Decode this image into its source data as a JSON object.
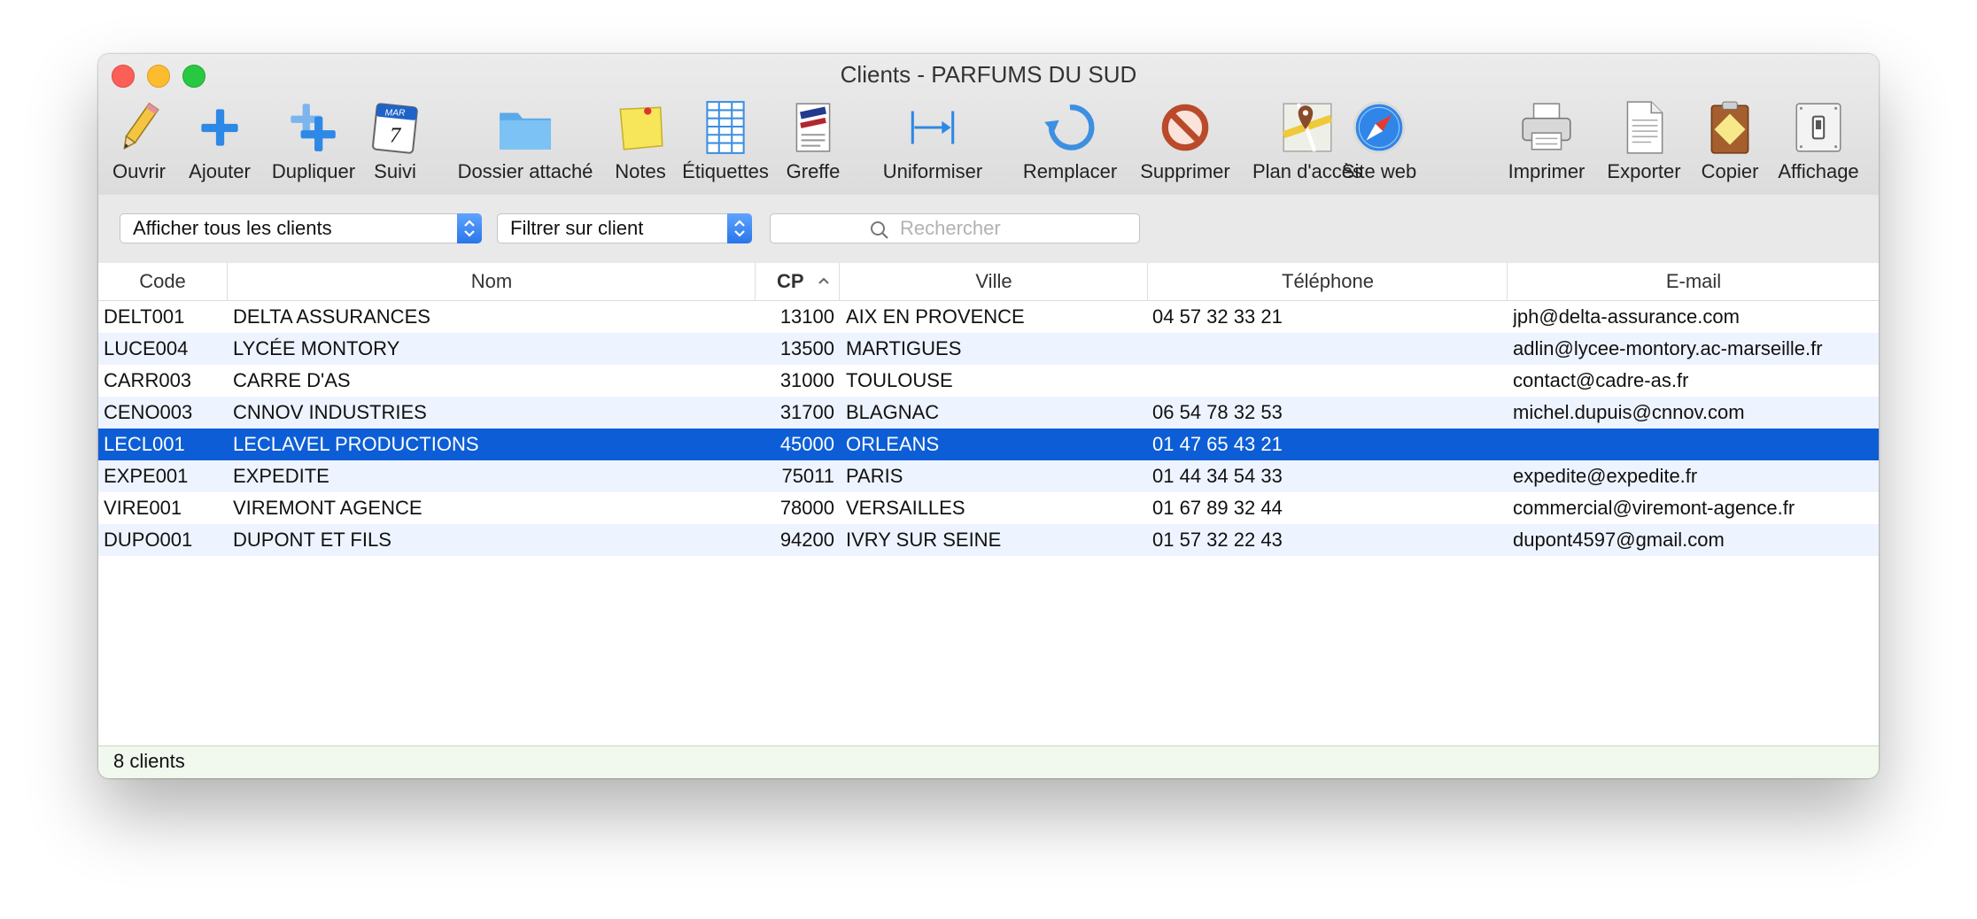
{
  "window": {
    "title": "Clients - PARFUMS DU SUD"
  },
  "toolbar": {
    "ouvrir": "Ouvrir",
    "ajouter": "Ajouter",
    "dupliquer": "Dupliquer",
    "suivi": "Suivi",
    "suivi_month": "MAR",
    "suivi_day": "7",
    "dossier": "Dossier attaché",
    "notes": "Notes",
    "etiquettes": "Étiquettes",
    "greffe": "Greffe",
    "uniformiser": "Uniformiser",
    "remplacer": "Remplacer",
    "supprimer": "Supprimer",
    "plan": "Plan d'accès",
    "site": "Site web",
    "imprimer": "Imprimer",
    "exporter": "Exporter",
    "copier": "Copier",
    "affichage": "Affichage"
  },
  "filters": {
    "show_select": "Afficher tous les clients",
    "filter_select": "Filtrer sur client",
    "search_placeholder": "Rechercher"
  },
  "table": {
    "columns": {
      "code": "Code",
      "nom": "Nom",
      "cp": "CP",
      "ville": "Ville",
      "telephone": "Téléphone",
      "email": "E-mail"
    },
    "sort_column": "CP",
    "sort_direction": "ascending",
    "selected_row": 4,
    "rows": [
      {
        "code": "DELT001",
        "nom": "DELTA ASSURANCES",
        "cp": "13100",
        "ville": "AIX EN PROVENCE",
        "tel": "04 57 32 33 21",
        "email": "jph@delta-assurance.com"
      },
      {
        "code": "LUCE004",
        "nom": "LYCÉE MONTORY",
        "cp": "13500",
        "ville": "MARTIGUES",
        "tel": "",
        "email": "adlin@lycee-montory.ac-marseille.fr"
      },
      {
        "code": "CARR003",
        "nom": "CARRE D'AS",
        "cp": "31000",
        "ville": "TOULOUSE",
        "tel": "",
        "email": "contact@cadre-as.fr"
      },
      {
        "code": "CENO003",
        "nom": "CNNOV INDUSTRIES",
        "cp": "31700",
        "ville": "BLAGNAC",
        "tel": "06 54 78 32 53",
        "email": "michel.dupuis@cnnov.com"
      },
      {
        "code": "LECL001",
        "nom": "LECLAVEL PRODUCTIONS",
        "cp": "45000",
        "ville": "ORLEANS",
        "tel": "01 47 65 43 21",
        "email": ""
      },
      {
        "code": "EXPE001",
        "nom": "EXPEDITE",
        "cp": "75011",
        "ville": "PARIS",
        "tel": "01 44 34 54 33",
        "email": "expedite@expedite.fr"
      },
      {
        "code": "VIRE001",
        "nom": "VIREMONT AGENCE",
        "cp": "78000",
        "ville": "VERSAILLES",
        "tel": "01 67 89 32 44",
        "email": "commercial@viremont-agence.fr"
      },
      {
        "code": "DUPO001",
        "nom": "DUPONT ET FILS",
        "cp": "94200",
        "ville": "IVRY SUR SEINE",
        "tel": "01 57 32 22 43",
        "email": "dupont4597@gmail.com"
      }
    ]
  },
  "status": {
    "count": "8 clients"
  },
  "colors": {
    "selection": "#0d5ed6",
    "alt_row": "#eef4ff",
    "status_bg": "#f1f8ee"
  }
}
